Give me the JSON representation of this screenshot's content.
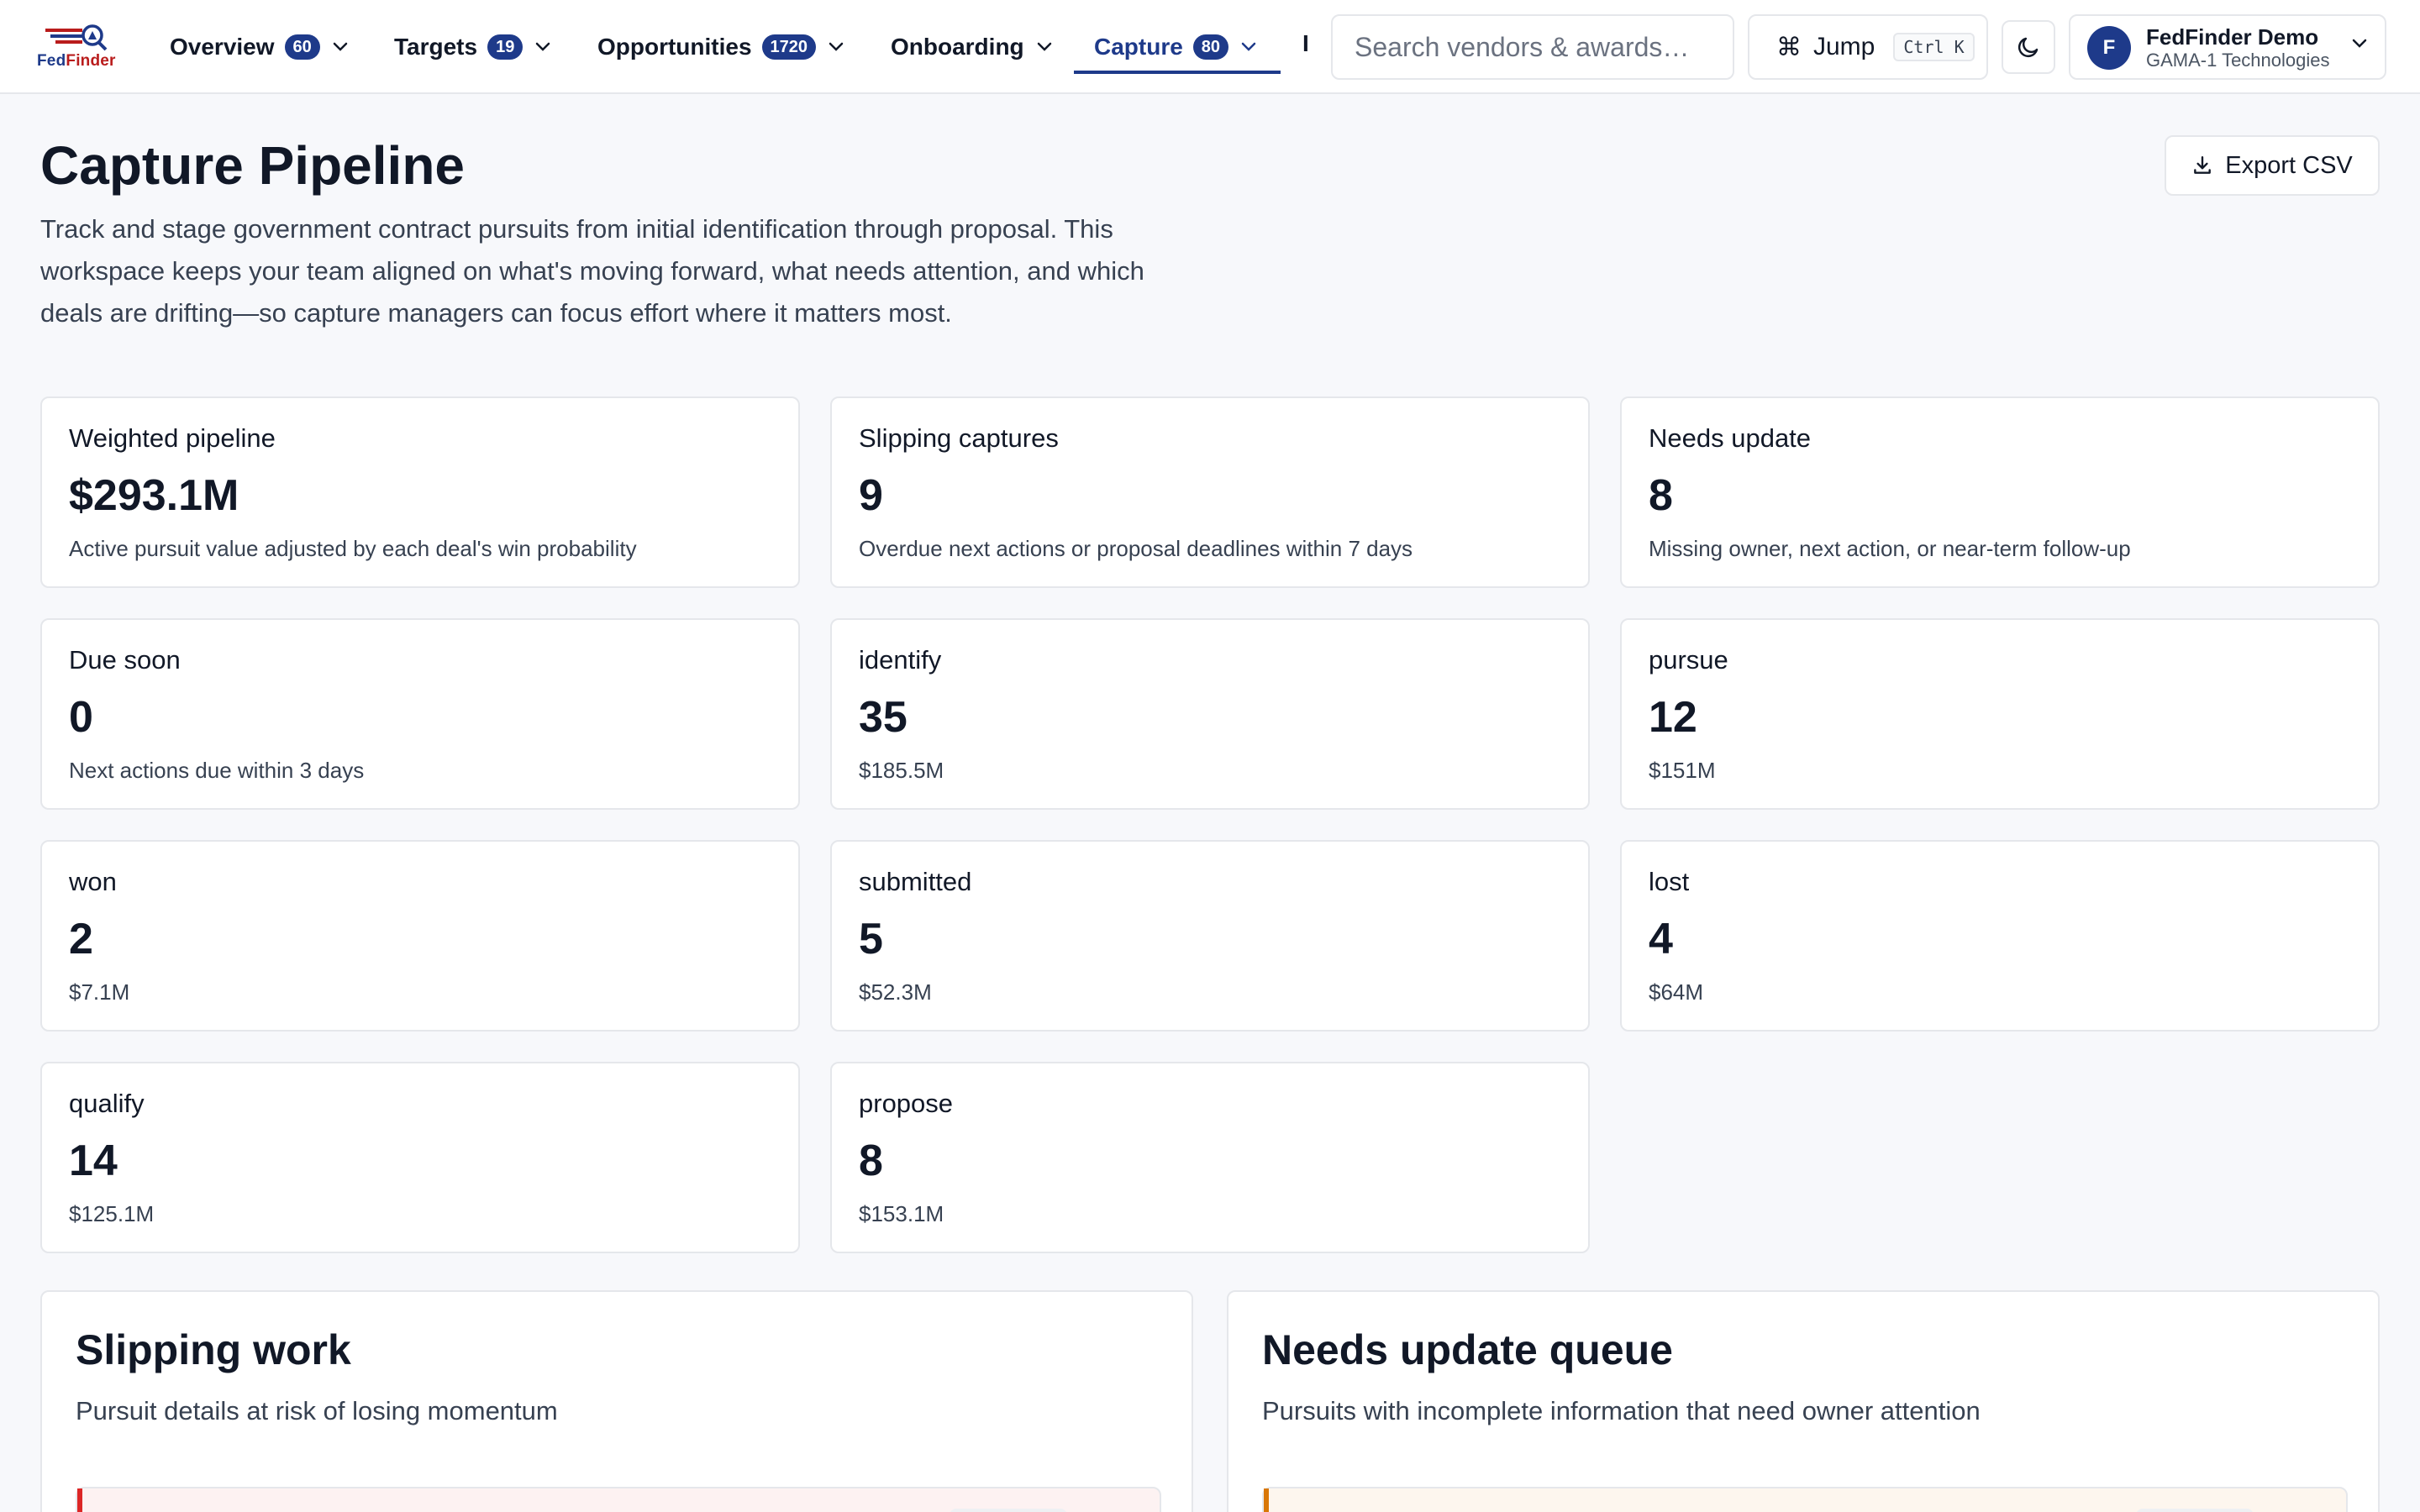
{
  "brand": {
    "fed": "Fed",
    "finder": "Finder"
  },
  "nav": {
    "items": [
      {
        "label": "Overview",
        "count": "60"
      },
      {
        "label": "Targets",
        "count": "19"
      },
      {
        "label": "Opportunities",
        "count": "1720"
      },
      {
        "label": "Onboarding",
        "count": ""
      },
      {
        "label": "Capture",
        "count": "80",
        "active": true
      }
    ],
    "overflow_label": "I"
  },
  "search": {
    "placeholder": "Search vendors & awards…"
  },
  "jump": {
    "label": "Jump",
    "shortcut": "Ctrl K"
  },
  "account": {
    "initial": "F",
    "name": "FedFinder Demo",
    "org": "GAMA-1 Technologies"
  },
  "page": {
    "title": "Capture Pipeline",
    "description": "Track and stage government contract pursuits from initial identification through proposal. This workspace keeps your team aligned on what's moving forward, what needs attention, and which deals are drifting—so capture managers can focus effort where it matters most.",
    "export_label": "Export CSV"
  },
  "stats": [
    {
      "label": "Weighted pipeline",
      "value": "$293.1M",
      "sub": "Active pursuit value adjusted by each deal's win probability"
    },
    {
      "label": "Slipping captures",
      "value": "9",
      "sub": "Overdue next actions or proposal deadlines within 7 days"
    },
    {
      "label": "Needs update",
      "value": "8",
      "sub": "Missing owner, next action, or near-term follow-up"
    },
    {
      "label": "Due soon",
      "value": "0",
      "sub": "Next actions due within 3 days"
    },
    {
      "label": "identify",
      "value": "35",
      "sub": "$185.5M"
    },
    {
      "label": "pursue",
      "value": "12",
      "sub": "$151M"
    },
    {
      "label": "won",
      "value": "2",
      "sub": "$7.1M"
    },
    {
      "label": "submitted",
      "value": "5",
      "sub": "$52.3M"
    },
    {
      "label": "lost",
      "value": "4",
      "sub": "$64M"
    },
    {
      "label": "qualify",
      "value": "14",
      "sub": "$125.1M"
    },
    {
      "label": "propose",
      "value": "8",
      "sub": "$153.1M"
    }
  ],
  "panels": {
    "slipping": {
      "title": "Slipping work",
      "subtitle": "Pursuit details at risk of losing momentum"
    },
    "needs_update": {
      "title": "Needs update queue",
      "subtitle": "Pursuits with incomplete information that need owner attention"
    }
  },
  "colors": {
    "brand": "#1e3a8a",
    "danger": "#dc2626",
    "warning": "#d97706"
  }
}
